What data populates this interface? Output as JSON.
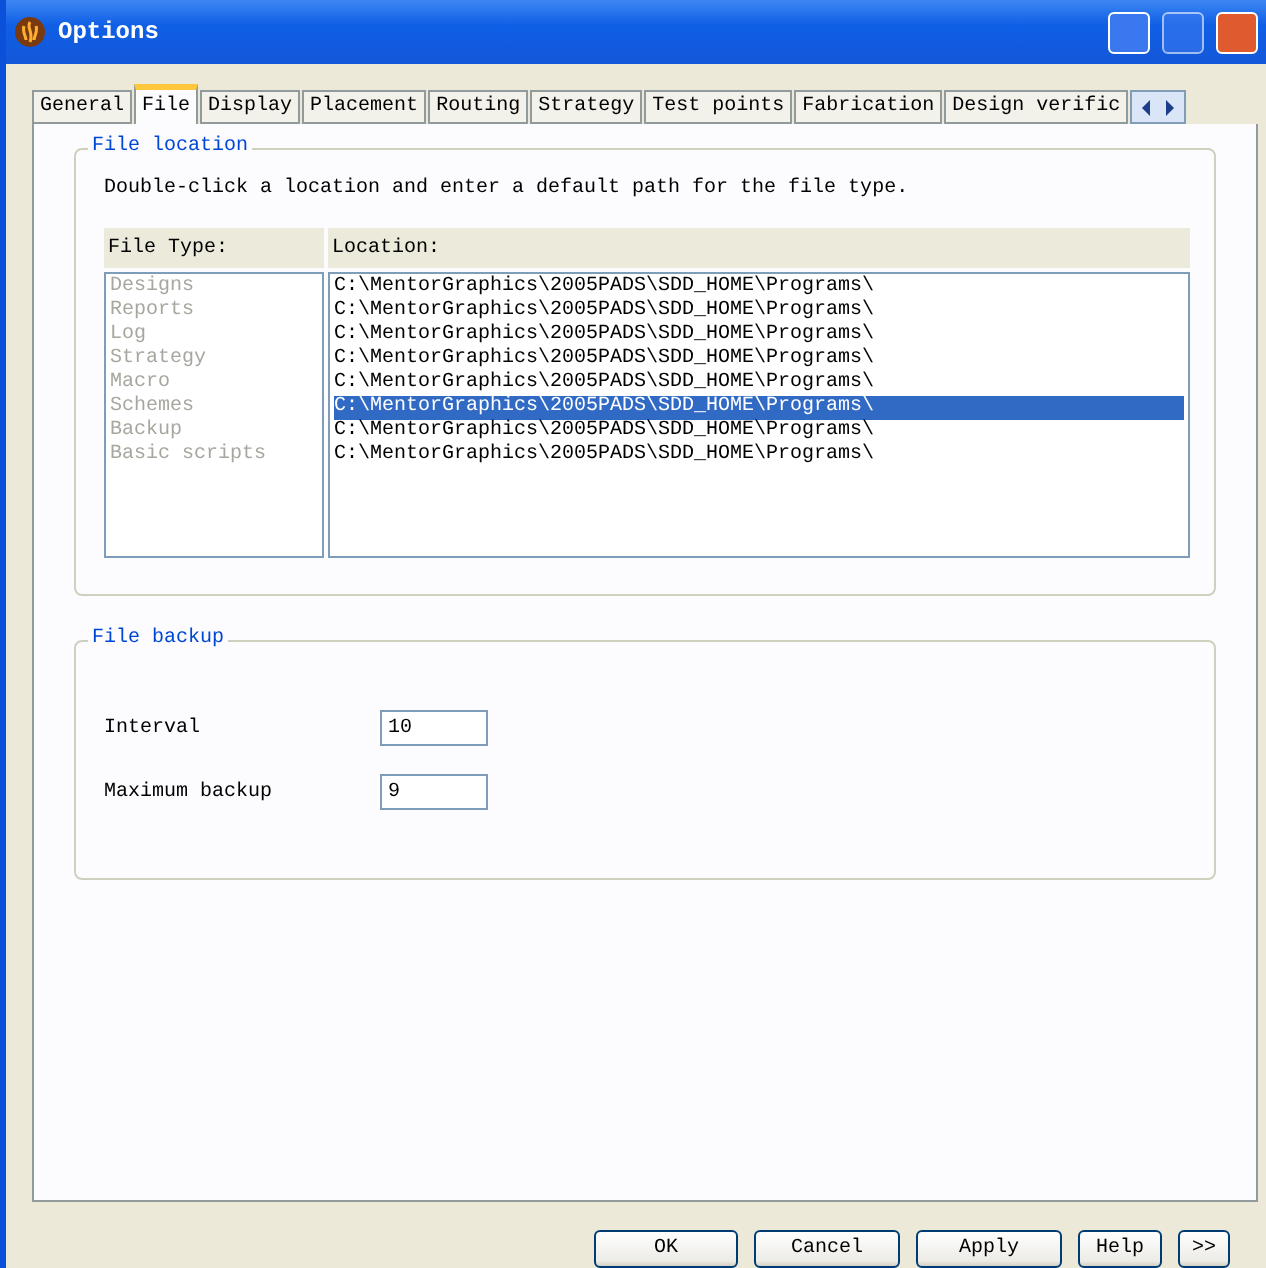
{
  "window": {
    "title": "Options"
  },
  "tabs": [
    {
      "label": "General",
      "selected": false
    },
    {
      "label": "File",
      "selected": true
    },
    {
      "label": "Display",
      "selected": false
    },
    {
      "label": "Placement",
      "selected": false
    },
    {
      "label": "Routing",
      "selected": false
    },
    {
      "label": "Strategy",
      "selected": false
    },
    {
      "label": "Test points",
      "selected": false
    },
    {
      "label": "Fabrication",
      "selected": false
    },
    {
      "label": "Design verific",
      "selected": false
    }
  ],
  "file_location": {
    "title": "File location",
    "instructions": "Double-click a location and enter a default path for the file type.",
    "columns": [
      "File Type:",
      "Location:"
    ],
    "rows": [
      {
        "type": "Designs",
        "location": "C:\\MentorGraphics\\2005PADS\\SDD_HOME\\Programs\\",
        "selected": false
      },
      {
        "type": "Reports",
        "location": "C:\\MentorGraphics\\2005PADS\\SDD_HOME\\Programs\\",
        "selected": false
      },
      {
        "type": "Log",
        "location": "C:\\MentorGraphics\\2005PADS\\SDD_HOME\\Programs\\",
        "selected": false
      },
      {
        "type": "Strategy",
        "location": "C:\\MentorGraphics\\2005PADS\\SDD_HOME\\Programs\\",
        "selected": false
      },
      {
        "type": "Macro",
        "location": "C:\\MentorGraphics\\2005PADS\\SDD_HOME\\Programs\\",
        "selected": false
      },
      {
        "type": "Schemes",
        "location": "C:\\MentorGraphics\\2005PADS\\SDD_HOME\\Programs\\",
        "selected": true
      },
      {
        "type": "Backup",
        "location": "C:\\MentorGraphics\\2005PADS\\SDD_HOME\\Programs\\",
        "selected": false
      },
      {
        "type": "Basic scripts",
        "location": "C:\\MentorGraphics\\2005PADS\\SDD_HOME\\Programs\\",
        "selected": false
      }
    ]
  },
  "file_backup": {
    "title": "File backup",
    "fields": [
      {
        "label": "Interval",
        "value": "10"
      },
      {
        "label": "Maximum backup",
        "value": "9"
      }
    ]
  },
  "buttons": [
    "OK",
    "Cancel",
    "Apply",
    "Help",
    ">>"
  ]
}
